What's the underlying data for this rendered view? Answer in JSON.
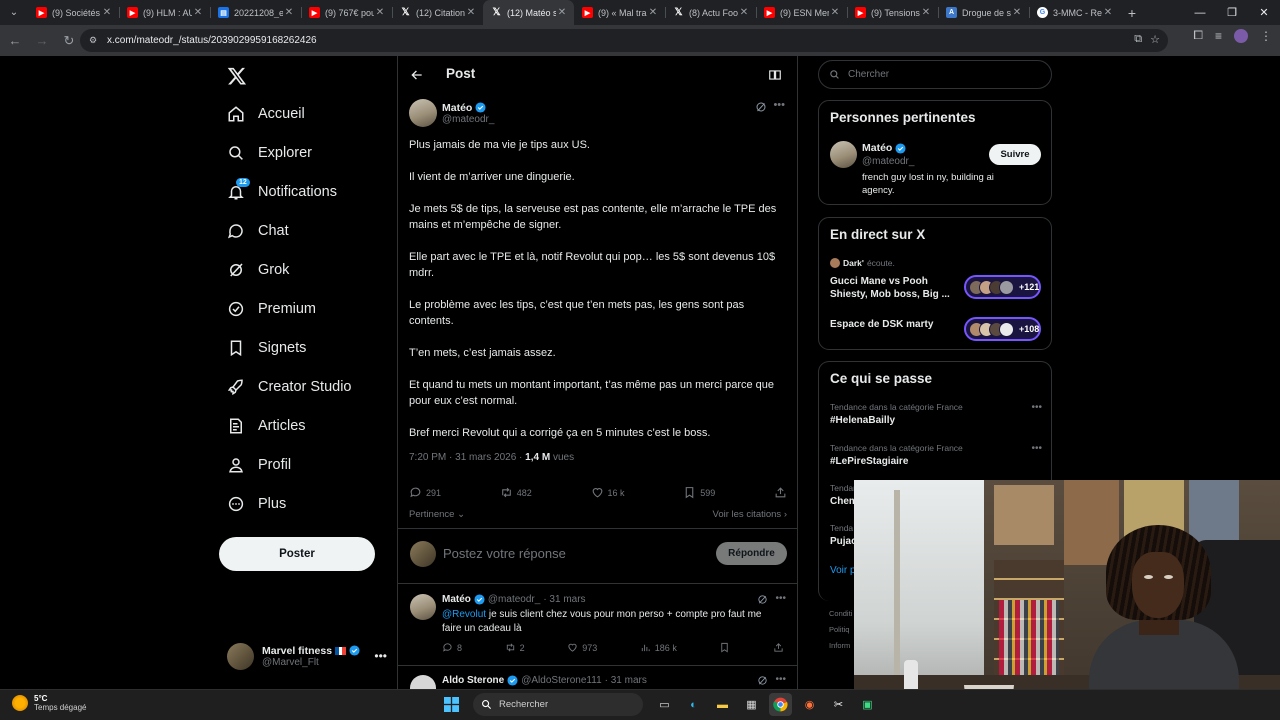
{
  "browser": {
    "tabs": [
      {
        "title": "(9) Sociétés",
        "favicon": "youtube-icon",
        "active": false
      },
      {
        "title": "(9) HLM : AU",
        "favicon": "youtube-icon",
        "active": false
      },
      {
        "title": "20221208_e",
        "favicon": "drive-icon",
        "active": false
      },
      {
        "title": "(9) 767€ pou",
        "favicon": "youtube-icon",
        "active": false
      },
      {
        "title": "(12) Citation",
        "favicon": "x-icon",
        "active": false
      },
      {
        "title": "(12) Matéo s",
        "favicon": "x-icon",
        "active": true
      },
      {
        "title": "(9) « Mal tra",
        "favicon": "youtube-icon",
        "active": false
      },
      {
        "title": "(8) Actu Foo",
        "favicon": "x-icon",
        "active": false
      },
      {
        "title": "(9) ESN Mer",
        "favicon": "youtube-icon",
        "active": false
      },
      {
        "title": "(9) Tensions",
        "favicon": "youtube-icon",
        "active": false
      },
      {
        "title": "Drogue de s",
        "favicon": "doc-icon",
        "active": false
      },
      {
        "title": "3-MMC - Re",
        "favicon": "google-icon",
        "active": false
      }
    ],
    "url": "x.com/mateodr_/status/2039029959168262426"
  },
  "nav": {
    "items": [
      {
        "label": "Accueil",
        "icon": "home-icon"
      },
      {
        "label": "Explorer",
        "icon": "search-icon"
      },
      {
        "label": "Notifications",
        "icon": "bell-icon",
        "badge": "12"
      },
      {
        "label": "Chat",
        "icon": "chat-icon"
      },
      {
        "label": "Grok",
        "icon": "grok-icon"
      },
      {
        "label": "Premium",
        "icon": "premium-icon"
      },
      {
        "label": "Signets",
        "icon": "bookmark-icon"
      },
      {
        "label": "Creator Studio",
        "icon": "rocket-icon"
      },
      {
        "label": "Articles",
        "icon": "articles-icon"
      },
      {
        "label": "Profil",
        "icon": "person-icon"
      },
      {
        "label": "Plus",
        "icon": "more-circle-icon"
      }
    ],
    "post_button": "Poster",
    "account": {
      "name": "Marvel fitness",
      "handle": "@Marvel_Flt"
    }
  },
  "main": {
    "title": "Post",
    "tweet": {
      "author_name": "Matéo",
      "author_handle": "@mateodr_",
      "paragraphs": [
        "Plus jamais de ma vie je tips aux US.",
        "Il vient de m’arriver une dinguerie.",
        "Je mets 5$ de tips, la serveuse est pas contente, elle m’arrache le TPE des mains et m’empêche de signer.",
        "Elle part avec le TPE et là, notif Revolut qui pop… les 5$ sont devenus 10$ mdrr.",
        "Le problème avec les tips, c’est que t’en mets pas, les gens sont pas contents.",
        "T’en mets, c’est jamais assez.",
        "Et quand tu mets un montant important, t’as même pas un merci parce que pour eux c’est normal.",
        "Bref merci Revolut qui a corrigé ça en 5 minutes c’est le boss."
      ],
      "time": "7:20 PM · 31 mars 2026 · ",
      "views_count": "1,4 M",
      "views_label": " vues",
      "replies": "291",
      "reposts": "482",
      "likes": "16 k",
      "bookmarks": "599"
    },
    "sort_label": "Pertinence",
    "quotes_label": "Voir les citations",
    "reply_placeholder": "Postez votre réponse",
    "reply_button": "Répondre",
    "replies": [
      {
        "name": "Matéo",
        "handle": "@mateodr_",
        "date": "· 31 mars",
        "mention": "@Revolut",
        "text": " je suis client chez vous pour mon perso + compte pro faut me faire un cadeau là",
        "replies": "8",
        "reposts": "2",
        "likes": "973",
        "views": "186 k"
      },
      {
        "name": "Aldo Sterone",
        "handle": "@AldoSterone111",
        "date": "· 31 mars"
      }
    ]
  },
  "right": {
    "search_placeholder": "Chercher",
    "relevant": {
      "title": "Personnes pertinentes",
      "name": "Matéo",
      "handle": "@mateodr_",
      "bio": "french guy lost in ny, building ai agency.",
      "follow": "Suivre"
    },
    "live": {
      "title": "En direct sur X",
      "host": "Dark'",
      "host_suffix": "écoute.",
      "spaces": [
        {
          "title": "Gucci Mane vs Pooh Shiesty, Mob boss, Big ...",
          "count": "+121"
        },
        {
          "title": "Espace de DSK marty",
          "count": "+108"
        }
      ]
    },
    "trends": {
      "title": "Ce qui se passe",
      "items": [
        {
          "category": "Tendance dans la catégorie France",
          "tag": "#HelenaBailly"
        },
        {
          "category": "Tendance dans la catégorie France",
          "tag": "#LePireStagiaire"
        },
        {
          "category": "Tendan",
          "tag": "Chem"
        },
        {
          "category": "Tenda",
          "tag": "Pujac"
        }
      ],
      "more": "Voir p"
    },
    "footer": [
      "Conditi",
      "Politiq",
      "Inform"
    ]
  },
  "taskbar": {
    "temp": "5°C",
    "weather": "Temps dégagé",
    "search": "Rechercher"
  },
  "colors": {
    "accent": "#1d9bf0",
    "background": "#000000",
    "live_border": "#7856ff"
  }
}
